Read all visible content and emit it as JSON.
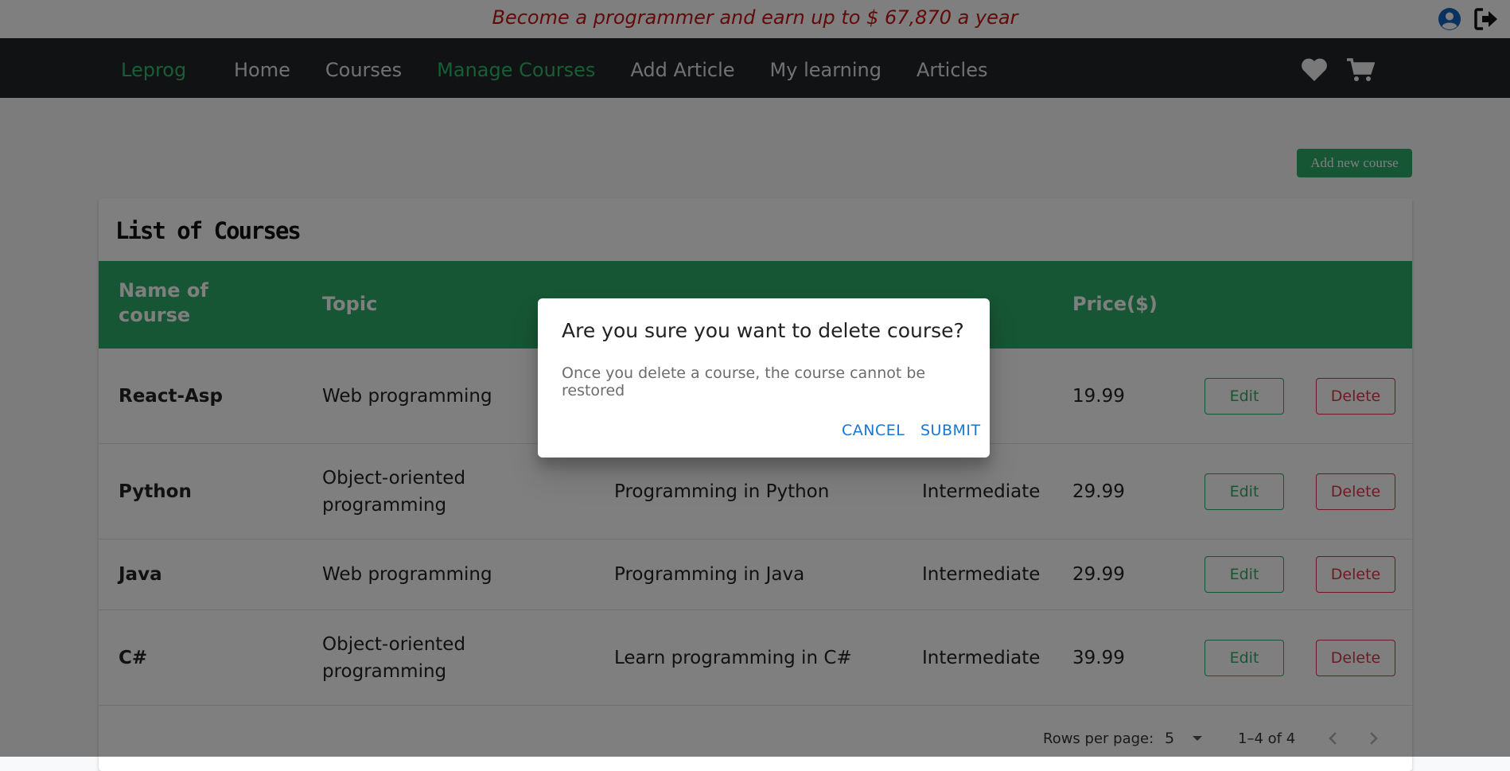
{
  "promo": {
    "text": "Become a programmer and earn up to $ 67,870 a year"
  },
  "header_icons": [
    "user-circle-icon",
    "sign-out-icon"
  ],
  "navbar": {
    "brand": "Leprog",
    "items": [
      {
        "label": "Home"
      },
      {
        "label": "Courses"
      },
      {
        "label": "Manage Courses",
        "active": true
      },
      {
        "label": "Add Article"
      },
      {
        "label": "My learning"
      },
      {
        "label": "Articles"
      }
    ],
    "right_icons": [
      "heart-icon",
      "cart-icon"
    ]
  },
  "page": {
    "add_button": "Add new course",
    "card_title": "List of Courses"
  },
  "table": {
    "headers": [
      "Name of\ncourse",
      "Topic",
      "Price($)"
    ],
    "rows": [
      {
        "name": "React-Asp",
        "topic": "Web programming",
        "level": "diate",
        "price": "19.99",
        "edit": "Edit",
        "delete": "Delete"
      },
      {
        "name": "Python",
        "topic": "Object-oriented\nprogramming",
        "title": "Programming in Python",
        "level": "Intermediate",
        "price": "29.99",
        "edit": "Edit",
        "delete": "Delete"
      },
      {
        "name": "Java",
        "topic": "Web programming",
        "title": "Programming in Java",
        "level": "Intermediate",
        "price": "29.99",
        "edit": "Edit",
        "delete": "Delete"
      },
      {
        "name": "C#",
        "topic": "Object-oriented\nprogramming",
        "title": "Learn programming in C#",
        "level": "Intermediate",
        "price": "39.99",
        "edit": "Edit",
        "delete": "Delete"
      }
    ]
  },
  "pagination": {
    "rows_per_page_label": "Rows per page:",
    "rows_per_page": "5",
    "range": "1–4 of 4"
  },
  "dialog": {
    "title": "Are you sure you want to delete course?",
    "body": "Once you delete a course, the course cannot be restored",
    "cancel": "CANCEL",
    "submit": "SUBMIT"
  },
  "colors": {
    "accent_green": "#2eac68",
    "danger_red": "#dc3545",
    "promo_red": "#c41414",
    "dialog_blue": "#1976d2"
  }
}
